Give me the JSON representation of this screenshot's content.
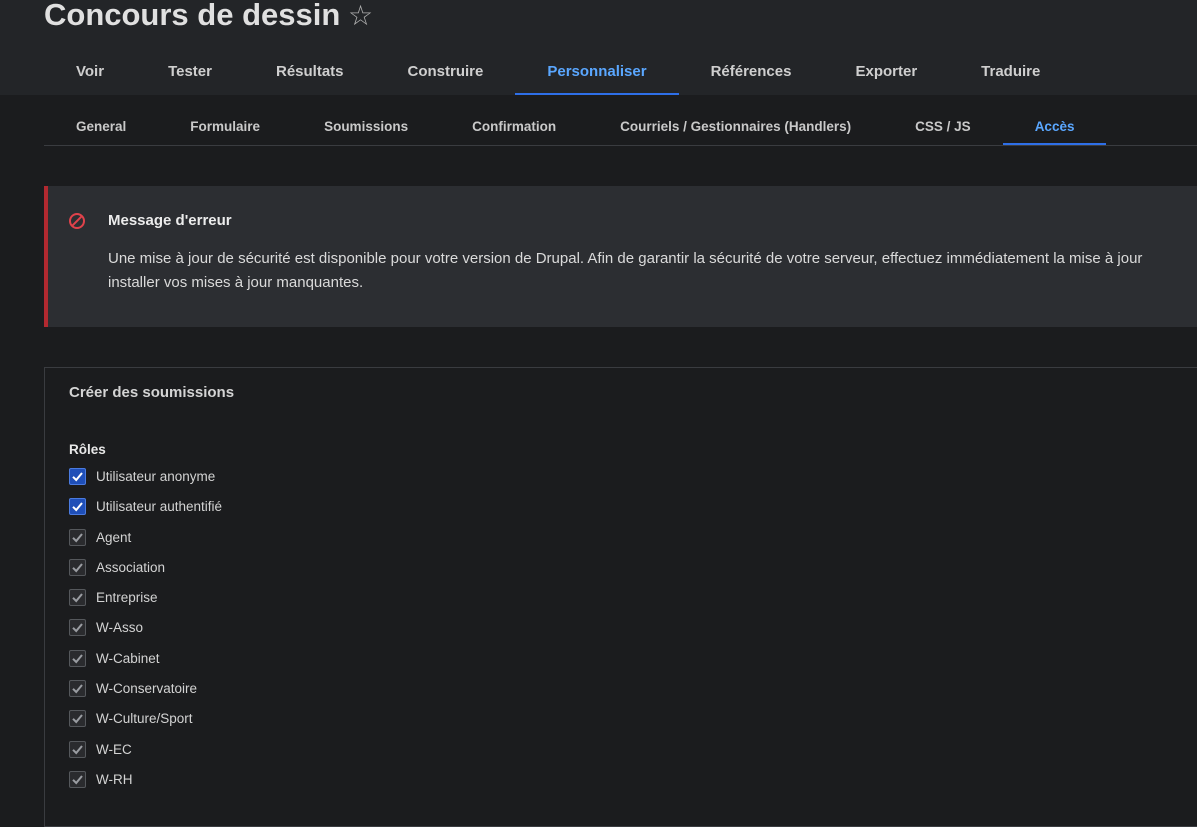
{
  "page": {
    "title": "Concours de dessin"
  },
  "primary_tabs": [
    {
      "label": "Voir",
      "active": false
    },
    {
      "label": "Tester",
      "active": false
    },
    {
      "label": "Résultats",
      "active": false
    },
    {
      "label": "Construire",
      "active": false
    },
    {
      "label": "Personnaliser",
      "active": true
    },
    {
      "label": "Références",
      "active": false
    },
    {
      "label": "Exporter",
      "active": false
    },
    {
      "label": "Traduire",
      "active": false
    }
  ],
  "secondary_tabs": [
    {
      "label": "General",
      "active": false
    },
    {
      "label": "Formulaire",
      "active": false
    },
    {
      "label": "Soumissions",
      "active": false
    },
    {
      "label": "Confirmation",
      "active": false
    },
    {
      "label": "Courriels / Gestionnaires (Handlers)",
      "active": false
    },
    {
      "label": "CSS / JS",
      "active": false
    },
    {
      "label": "Accès",
      "active": true
    }
  ],
  "alert": {
    "title": "Message d'erreur",
    "body": "Une mise à jour de sécurité est disponible pour votre version de Drupal. Afin de garantir la sécurité de votre serveur, effectuez immédiatement la mise à jour\ninstaller vos mises à jour manquantes."
  },
  "fieldset": {
    "legend": "Créer des soumissions",
    "roles_label": "Rôles",
    "roles": [
      {
        "label": "Utilisateur anonyme",
        "checked": true,
        "disabled": false
      },
      {
        "label": "Utilisateur authentifié",
        "checked": true,
        "disabled": false
      },
      {
        "label": "Agent",
        "checked": true,
        "disabled": true
      },
      {
        "label": "Association",
        "checked": true,
        "disabled": true
      },
      {
        "label": "Entreprise",
        "checked": true,
        "disabled": true
      },
      {
        "label": "W-Asso",
        "checked": true,
        "disabled": true
      },
      {
        "label": "W-Cabinet",
        "checked": true,
        "disabled": true
      },
      {
        "label": "W-Conservatoire",
        "checked": true,
        "disabled": true
      },
      {
        "label": "W-Culture/Sport",
        "checked": true,
        "disabled": true
      },
      {
        "label": "W-EC",
        "checked": true,
        "disabled": true
      },
      {
        "label": "W-RH",
        "checked": true,
        "disabled": true
      }
    ]
  },
  "colors": {
    "accent": "#5aa7ff",
    "tab_underline": "#2e6fe8",
    "error": "#b22930",
    "checkbox_checked": "#1f4fb8"
  }
}
